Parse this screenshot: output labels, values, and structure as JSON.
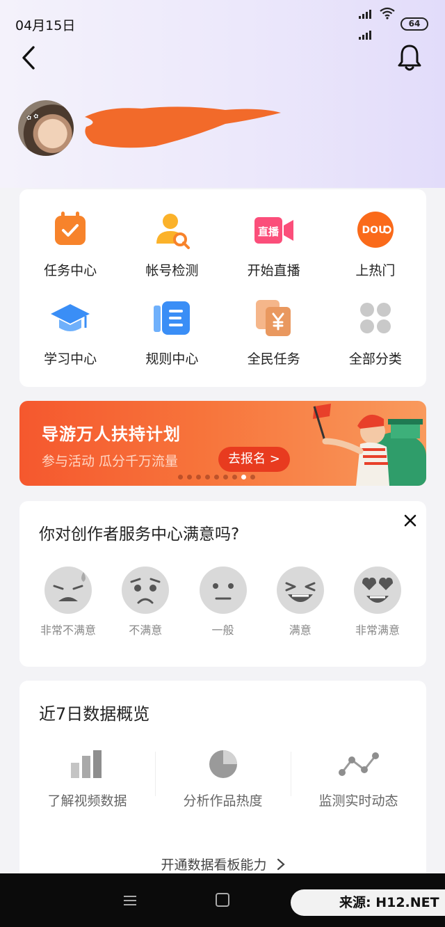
{
  "status_bar": {
    "time": "04月15日",
    "battery": "64"
  },
  "tools": [
    {
      "label": "任务中心",
      "icon": "task-calendar-icon"
    },
    {
      "label": "帐号检测",
      "icon": "account-check-icon"
    },
    {
      "label": "开始直播",
      "icon": "live-camera-icon"
    },
    {
      "label": "上热门",
      "icon": "dou-plus-icon"
    },
    {
      "label": "学习中心",
      "icon": "graduation-cap-icon"
    },
    {
      "label": "规则中心",
      "icon": "rules-document-icon"
    },
    {
      "label": "全民任务",
      "icon": "yuan-cards-icon"
    },
    {
      "label": "全部分类",
      "icon": "grid-dots-icon"
    }
  ],
  "live_icon_text": "直播",
  "dou_icon_text": "DOU",
  "banner": {
    "title": "导游万人扶持计划",
    "subtitle": "参与活动  瓜分千万流量",
    "button": "去报名 >",
    "dots_total": 9,
    "dots_active_index": 7
  },
  "survey": {
    "title": "你对创作者服务中心满意吗?",
    "options": [
      "非常不满意",
      "不满意",
      "一般",
      "满意",
      "非常满意"
    ]
  },
  "data_overview": {
    "title": "近7日数据概览",
    "items": [
      "了解视频数据",
      "分析作品热度",
      "监测实时动态"
    ],
    "link": "开通数据看板能力"
  },
  "watermark": "来源: H12.NET",
  "colors": {
    "accent": "#f5582e",
    "page_bg": "#f3f3f6",
    "card_bg": "#ffffff"
  }
}
